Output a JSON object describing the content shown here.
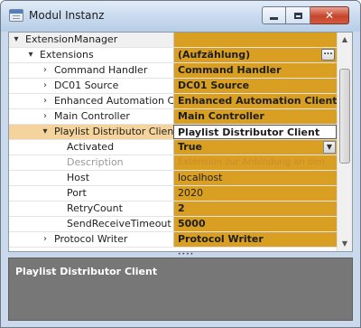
{
  "window": {
    "title": "Modul Instanz"
  },
  "rows": [
    {
      "label": "ExtensionManager",
      "value": "",
      "expander": "▾"
    },
    {
      "label": "Extensions",
      "value": "(Aufzählung)",
      "expander": "▾"
    },
    {
      "label": "Command Handler",
      "value": "Command Handler",
      "expander": "›"
    },
    {
      "label": "DC01 Source",
      "value": "DC01 Source",
      "expander": "›"
    },
    {
      "label": "Enhanced Automation Client",
      "value": "Enhanced Automation Client",
      "expander": "›"
    },
    {
      "label": "Main Controller",
      "value": "Main Controller",
      "expander": "›"
    },
    {
      "label": "Playlist Distributor Client",
      "value": "Playlist Distributor Client",
      "expander": "▾"
    },
    {
      "label": "Activated",
      "value": "True"
    },
    {
      "label": "Description",
      "value": "Extension zur Anbindung an den"
    },
    {
      "label": "Host",
      "value": "localhost"
    },
    {
      "label": "Port",
      "value": "2020"
    },
    {
      "label": "RetryCount",
      "value": "2"
    },
    {
      "label": "SendReceiveTimeout",
      "value": "5000"
    },
    {
      "label": "Protocol Writer",
      "value": "Protocol Writer",
      "expander": "›"
    }
  ],
  "description": {
    "title": "Playlist Distributor Client"
  },
  "colors": {
    "value_bg": "#d89f22",
    "selected_name_bg": "#f4d39d",
    "description_bg": "#777777"
  }
}
